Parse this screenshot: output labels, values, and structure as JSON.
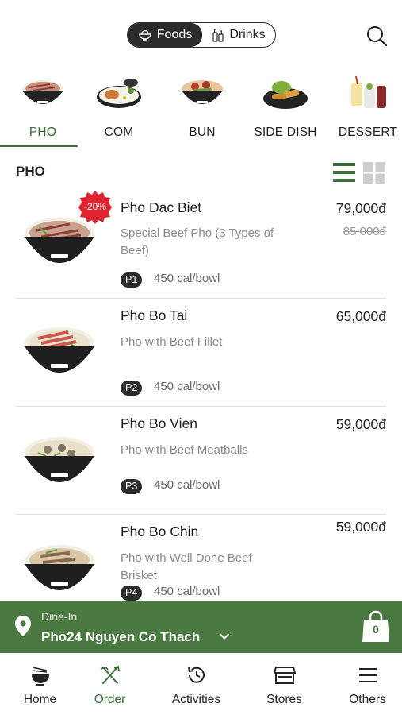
{
  "top": {
    "tabs": [
      {
        "label": "Foods",
        "icon": "bowl-icon",
        "active": true
      },
      {
        "label": "Drinks",
        "icon": "bottles-icon",
        "active": false
      }
    ],
    "search_icon": "search-icon"
  },
  "categories": [
    {
      "label": "PHO",
      "active": true
    },
    {
      "label": "COM",
      "active": false
    },
    {
      "label": "BUN",
      "active": false
    },
    {
      "label": "SIDE DISH",
      "active": false
    },
    {
      "label": "DESSERT",
      "active": false
    }
  ],
  "section": {
    "title": "PHO",
    "view_modes": [
      "list",
      "grid"
    ],
    "active_view": "list"
  },
  "items": [
    {
      "name": "Pho Dac Biet",
      "description": "Special Beef Pho (3 Types of Beef)",
      "price": "79,000đ",
      "old_price": "85,000đ",
      "discount": "-20%",
      "code": "P1",
      "calories": "450 cal/bowl"
    },
    {
      "name": "Pho Bo Tai",
      "description": "Pho with Beef Fillet",
      "price": "65,000đ",
      "code": "P2",
      "calories": "450 cal/bowl"
    },
    {
      "name": "Pho Bo Vien",
      "description": "Pho with Beef Meatballs",
      "price": "59,000đ",
      "code": "P3",
      "calories": "450 cal/bowl"
    },
    {
      "name": "Pho Bo Chin",
      "description": "Pho with Well Done Beef Brisket",
      "price": "59,000đ",
      "code": "P4",
      "calories": "450 cal/bowl"
    }
  ],
  "dine_bar": {
    "mode": "Dine-In",
    "store": "Pho24 Nguyen Co Thach",
    "cart_count": "0"
  },
  "nav": [
    {
      "label": "Home",
      "icon": "noodle-bowl-icon",
      "active": false
    },
    {
      "label": "Order",
      "icon": "utensils-icon",
      "active": true
    },
    {
      "label": "Activities",
      "icon": "history-icon",
      "active": false
    },
    {
      "label": "Stores",
      "icon": "store-icon",
      "active": false
    },
    {
      "label": "Others",
      "icon": "menu-icon",
      "active": false
    }
  ],
  "colors": {
    "brand_green": "#4a7a41",
    "active_green": "#3d6b3a",
    "dark": "#2b2b2b",
    "discount_red": "#e0242f"
  }
}
